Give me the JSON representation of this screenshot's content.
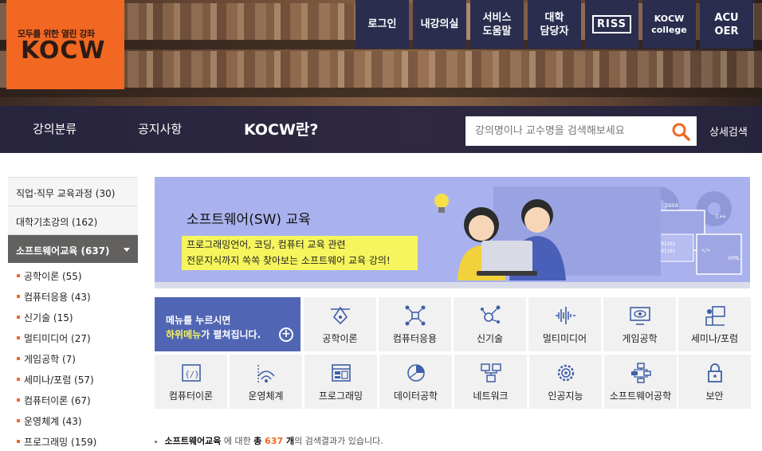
{
  "logo": {
    "tagline": "모두를 위한 열린 강좌",
    "wordmark": "KOCW"
  },
  "top_buttons": [
    {
      "label": "로그인"
    },
    {
      "label": "내강의실"
    },
    {
      "label": "서비스\n도움말"
    },
    {
      "label": "대학\n담당자"
    },
    {
      "label": "RISS"
    },
    {
      "label": "KOCW\ncollege"
    },
    {
      "label": "ACU\nOER"
    }
  ],
  "nav": {
    "items": [
      "강의분류",
      "공지사항"
    ],
    "about": "KOCW란?",
    "search_placeholder": "강의명이나 교수명을 검색해보세요",
    "advanced_search": "상세검색"
  },
  "sidebar": {
    "categories": [
      {
        "label": "직업·직무 교육과정 (30)"
      },
      {
        "label": "대학기초강의 (162)"
      },
      {
        "label": "소프트웨어교육 (637)",
        "active": true
      }
    ],
    "subitems": [
      "공학이론 (55)",
      "컴퓨터응용 (43)",
      "신기술 (15)",
      "멀티미디어 (27)",
      "게임공학 (7)",
      "세미나/포럼 (57)",
      "컴퓨터이론 (67)",
      "운영체계 (43)",
      "프로그래밍 (159)"
    ]
  },
  "banner": {
    "title": "소프트웨어(SW) 교육",
    "subtitle_line1": "프로그래밍언어, 코딩, 컴퓨터 교육 관련",
    "subtitle_line2": "전문지식까지 쏙쏙 찾아보는 소프트웨어 교육 강의!"
  },
  "menu_card": {
    "line1": "메뉴를 누르시면",
    "line2_highlight": "하위메뉴",
    "line2_rest": "가 펼쳐집니다."
  },
  "grid": {
    "row1": [
      {
        "label": "공학이론",
        "icon": "vector-pen-icon"
      },
      {
        "label": "컴퓨터응용",
        "icon": "network-nodes-icon"
      },
      {
        "label": "신기술",
        "icon": "molecule-icon"
      },
      {
        "label": "멀티미디어",
        "icon": "audio-wave-icon"
      },
      {
        "label": "게임공학",
        "icon": "monitor-eye-icon"
      },
      {
        "label": "세미나/포럼",
        "icon": "presenter-icon"
      }
    ],
    "row2": [
      {
        "label": "컴퓨터이론",
        "icon": "code-window-icon"
      },
      {
        "label": "운영체계",
        "icon": "wifi-signal-icon"
      },
      {
        "label": "프로그래밍",
        "icon": "window-layout-icon"
      },
      {
        "label": "데이터공학",
        "icon": "pie-chart-icon"
      },
      {
        "label": "네트워크",
        "icon": "network-monitors-icon"
      },
      {
        "label": "인공지능",
        "icon": "ai-gear-icon"
      },
      {
        "label": "소프트웨어공학",
        "icon": "flowchart-icon"
      },
      {
        "label": "보안",
        "icon": "lock-icon"
      }
    ]
  },
  "result": {
    "category": "소프트웨어교육",
    "text1": " 에 대한 ",
    "total_label": "총 ",
    "count": "637",
    "unit": " 개",
    "text2": "의 검색결과가 있습니다."
  },
  "colors": {
    "brand_orange": "#f26722",
    "nav_dark": "#2a2d4e",
    "menu_blue": "#5066b4",
    "banner_lavender": "#a9b2ee",
    "highlight_yellow": "#f6f55e"
  }
}
